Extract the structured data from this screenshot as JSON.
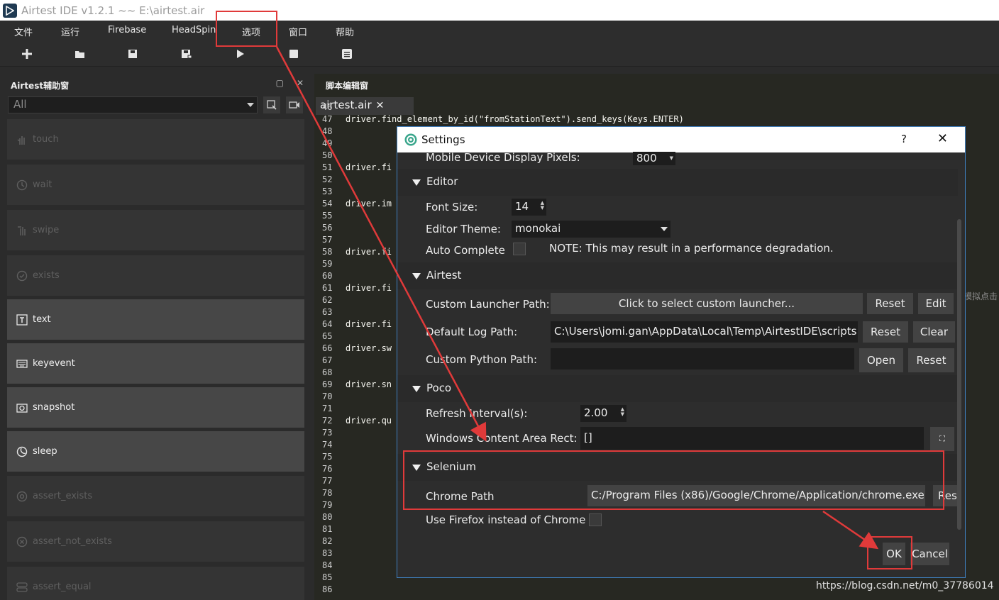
{
  "window": {
    "title": "Airtest IDE v1.2.1 ~~ E:\\airtest.air"
  },
  "menu": [
    "文件",
    "运行",
    "Firebase",
    "HeadSpin",
    "选项",
    "窗口",
    "帮助"
  ],
  "toolbar_icons": [
    "plus-icon",
    "folder-open-icon",
    "save-icon",
    "save-as-icon",
    "play-icon",
    "stop-icon",
    "log-icon"
  ],
  "left_panel": {
    "title": "Airtest辅助窗",
    "filter_value": "All",
    "items": [
      {
        "label": "touch",
        "icon": "hand-icon",
        "enabled": false
      },
      {
        "label": "wait",
        "icon": "clock-icon",
        "enabled": false
      },
      {
        "label": "swipe",
        "icon": "swipe-icon",
        "enabled": false
      },
      {
        "label": "exists",
        "icon": "check-circle-icon",
        "enabled": false
      },
      {
        "label": "text",
        "icon": "text-icon",
        "enabled": true
      },
      {
        "label": "keyevent",
        "icon": "keyboard-icon",
        "enabled": true
      },
      {
        "label": "snapshot",
        "icon": "camera-icon",
        "enabled": true
      },
      {
        "label": "sleep",
        "icon": "moon-icon",
        "enabled": true
      },
      {
        "label": "assert_exists",
        "icon": "target-icon",
        "enabled": false
      },
      {
        "label": "assert_not_exists",
        "icon": "target-x-icon",
        "enabled": false
      },
      {
        "label": "assert_equal",
        "icon": "equal-icon",
        "enabled": false
      }
    ]
  },
  "editor": {
    "title": "脚本编辑窗",
    "tab": "airtest.air",
    "first_line": 46,
    "last_line": 86,
    "code": [
      {
        "line": 47,
        "text": "driver.find_element_by_id(\"fromStationText\").send_keys(Keys.ENTER)"
      },
      {
        "line": 51,
        "text": "driver.fi"
      },
      {
        "line": 54,
        "text": "driver.im"
      },
      {
        "line": 58,
        "text": "driver.fi"
      },
      {
        "line": 61,
        "text": "driver.fi"
      },
      {
        "line": 64,
        "text": "driver.fi"
      },
      {
        "line": 66,
        "text": "driver.sw"
      },
      {
        "line": 69,
        "text": "driver.sn"
      },
      {
        "line": 72,
        "text": "driver.qu"
      }
    ],
    "side_text": "模拟点击"
  },
  "watermark": "https://blog.csdn.net/m0_37786014",
  "settings": {
    "title": "Settings",
    "help": "?",
    "mobile_display_label": "Mobile Device Display Pixels:",
    "mobile_display_value": "800",
    "editor_section": "Editor",
    "font_size_label": "Font Size:",
    "font_size_value": "14",
    "theme_label": "Editor Theme:",
    "theme_value": "monokai",
    "autocomplete_label": "Auto Complete",
    "autocomplete_note": "NOTE: This may result in a performance degradation.",
    "airtest_section": "Airtest",
    "launcher_label": "Custom Launcher Path:",
    "launcher_button": "Click to select custom launcher...",
    "reset": "Reset",
    "edit": "Edit",
    "log_label": "Default Log Path:",
    "log_value": "C:\\Users\\jomi.gan\\AppData\\Local\\Temp\\AirtestIDE\\scripts",
    "clear": "Clear",
    "python_label": "Custom Python Path:",
    "python_value": "",
    "open": "Open",
    "poco_section": "Poco",
    "refresh_label": "Refresh Interval(s):",
    "refresh_value": "2.00",
    "rect_label": "Windows Content Area Rect:",
    "rect_value": "[]",
    "selenium_section": "Selenium",
    "chrome_label": "Chrome Path",
    "chrome_value": "C:/Program Files (x86)/Google/Chrome/Application/chrome.exe",
    "chrome_reset": "Rese",
    "firefox_label": "Use Firefox instead of Chrome",
    "ok": "OK",
    "cancel": "Cancel"
  },
  "colors": {
    "annotation": "#e03a3a",
    "dialog_border": "#3f7fbf"
  }
}
